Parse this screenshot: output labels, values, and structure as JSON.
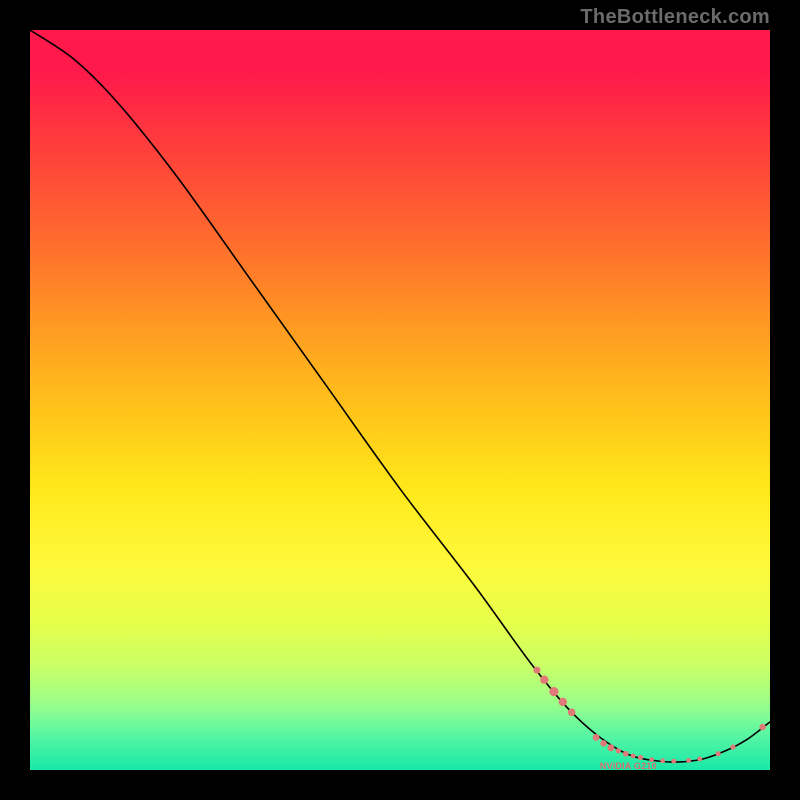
{
  "watermark": "TheBottleneck.com",
  "series_label": "NVIDIA G210",
  "chart_data": {
    "type": "line",
    "title": "",
    "xlabel": "",
    "ylabel": "",
    "xlim": [
      0,
      100
    ],
    "ylim": [
      0,
      100
    ],
    "curve": {
      "name": "bottleneck-curve",
      "points": [
        {
          "x": 0,
          "y": 100
        },
        {
          "x": 6,
          "y": 96
        },
        {
          "x": 12,
          "y": 90
        },
        {
          "x": 20,
          "y": 80
        },
        {
          "x": 30,
          "y": 66
        },
        {
          "x": 40,
          "y": 52
        },
        {
          "x": 50,
          "y": 38
        },
        {
          "x": 60,
          "y": 25
        },
        {
          "x": 68,
          "y": 14
        },
        {
          "x": 74,
          "y": 7
        },
        {
          "x": 80,
          "y": 2.5
        },
        {
          "x": 85,
          "y": 1.2
        },
        {
          "x": 90,
          "y": 1.3
        },
        {
          "x": 94,
          "y": 2.6
        },
        {
          "x": 97,
          "y": 4.2
        },
        {
          "x": 100,
          "y": 6.5
        }
      ]
    },
    "series": [
      {
        "name": "NVIDIA G210",
        "color": "#e07a78",
        "points": [
          {
            "x": 68.5,
            "y": 13.5,
            "r": 3.5
          },
          {
            "x": 69.5,
            "y": 12.2,
            "r": 4.2
          },
          {
            "x": 70.8,
            "y": 10.6,
            "r": 4.6
          },
          {
            "x": 72.0,
            "y": 9.2,
            "r": 4.2
          },
          {
            "x": 73.2,
            "y": 7.8,
            "r": 3.8
          },
          {
            "x": 76.5,
            "y": 4.4,
            "r": 3.4
          },
          {
            "x": 77.5,
            "y": 3.6,
            "r": 3.2
          },
          {
            "x": 78.5,
            "y": 3.0,
            "r": 3.5
          },
          {
            "x": 79.5,
            "y": 2.6,
            "r": 2.6
          },
          {
            "x": 80.5,
            "y": 2.2,
            "r": 2.8
          },
          {
            "x": 81.5,
            "y": 1.9,
            "r": 2.4
          },
          {
            "x": 82.5,
            "y": 1.7,
            "r": 2.6
          },
          {
            "x": 84.0,
            "y": 1.4,
            "r": 2.4
          },
          {
            "x": 85.5,
            "y": 1.25,
            "r": 2.4
          },
          {
            "x": 87.0,
            "y": 1.2,
            "r": 2.4
          },
          {
            "x": 89.0,
            "y": 1.3,
            "r": 2.4
          },
          {
            "x": 90.5,
            "y": 1.5,
            "r": 2.4
          },
          {
            "x": 93.0,
            "y": 2.2,
            "r": 2.6
          },
          {
            "x": 95.0,
            "y": 3.1,
            "r": 2.6
          },
          {
            "x": 99.0,
            "y": 5.8,
            "r": 3.2
          }
        ]
      }
    ],
    "label_anchor": {
      "x": 77,
      "y": 1.0
    }
  }
}
